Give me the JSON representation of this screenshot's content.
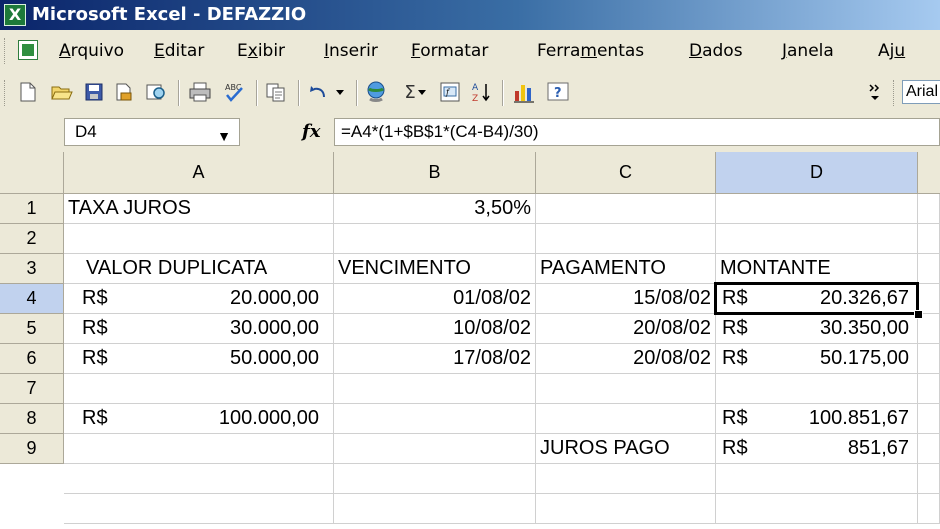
{
  "window": {
    "title": "Microsoft Excel - DEFAZZIO",
    "app_icon": "excel-icon"
  },
  "menu": {
    "items": [
      {
        "label": "Arquivo",
        "mnemonic_index": 0
      },
      {
        "label": "Editar",
        "mnemonic_index": 0
      },
      {
        "label": "Exibir",
        "mnemonic_index": 1
      },
      {
        "label": "Inserir",
        "mnemonic_index": 0
      },
      {
        "label": "Formatar",
        "mnemonic_index": 0
      },
      {
        "label": "Ferramentas",
        "mnemonic_index": 5
      },
      {
        "label": "Dados",
        "mnemonic_index": 0
      },
      {
        "label": "Janela",
        "mnemonic_index": 0
      },
      {
        "label": "Aju",
        "mnemonic_index": 2
      }
    ]
  },
  "toolbar": {
    "icons": [
      "new-icon",
      "open-icon",
      "save-icon",
      "permission-icon",
      "research-icon",
      "print-icon",
      "spelling-icon",
      "copy-icon",
      "undo-icon",
      "hyperlink-icon",
      "autosum-icon",
      "insert-function-icon",
      "sort-ascending-icon",
      "chart-wizard-icon",
      "help-icon",
      "more-buttons-icon"
    ],
    "font_name": "Arial"
  },
  "formula_bar": {
    "name_box": "D4",
    "fx_label": "fx",
    "formula": "=A4*(1+$B$1*(C4-B4)/30)"
  },
  "sheet": {
    "columns": [
      "A",
      "B",
      "C",
      "D"
    ],
    "rows": [
      "1",
      "2",
      "3",
      "4",
      "5",
      "6",
      "7",
      "8",
      "9"
    ],
    "active_cell": "D4",
    "cells": {
      "A1": "TAXA JUROS",
      "B1": "3,50%",
      "A3": "VALOR DUPLICATA",
      "B3": "VENCIMENTO",
      "C3": "PAGAMENTO",
      "D3": "MONTANTE",
      "A4_cur": "R$",
      "A4": "20.000,00",
      "B4": "01/08/02",
      "C4": "15/08/02",
      "D4_cur": "R$",
      "D4": "20.326,67",
      "A5_cur": "R$",
      "A5": "30.000,00",
      "B5": "10/08/02",
      "C5": "20/08/02",
      "D5_cur": "R$",
      "D5": "30.350,00",
      "A6_cur": "R$",
      "A6": "50.000,00",
      "B6": "17/08/02",
      "C6": "20/08/02",
      "D6_cur": "R$",
      "D6": "50.175,00",
      "A8_cur": "R$",
      "A8": "100.000,00",
      "D8_cur": "R$",
      "D8": "100.851,67",
      "C9": "JUROS PAGO",
      "D9_cur": "R$",
      "D9": "851,67"
    }
  },
  "colors": {
    "title_gradient_start": "#0a246a",
    "chrome": "#ece9d8",
    "active_header": "#c1d2ee"
  }
}
